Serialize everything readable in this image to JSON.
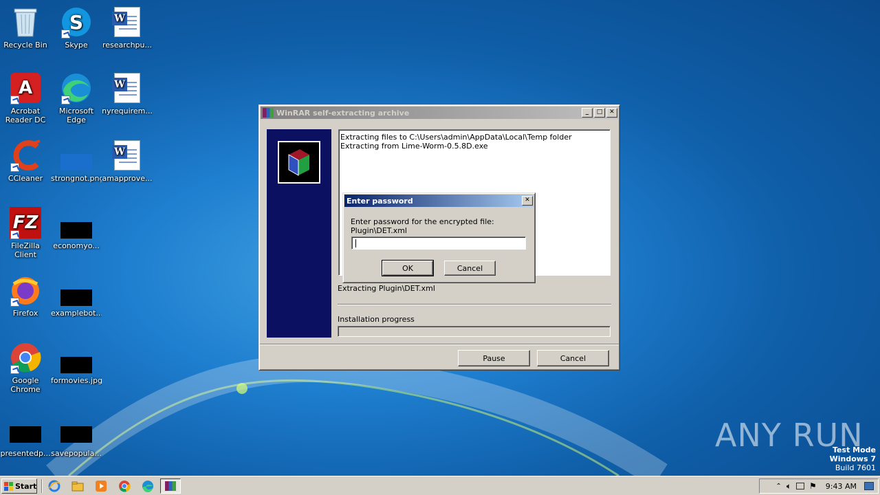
{
  "desktop": {
    "icons": [
      {
        "label": "Recycle Bin",
        "icon": "recycle-bin-icon"
      },
      {
        "label": "Skype",
        "icon": "skype-icon"
      },
      {
        "label": "researchpu...",
        "icon": "word-document-icon"
      },
      {
        "label": "Acrobat Reader DC",
        "icon": "acrobat-icon"
      },
      {
        "label": "Microsoft Edge",
        "icon": "edge-icon"
      },
      {
        "label": "nyrequirem...",
        "icon": "word-document-icon"
      },
      {
        "label": "CCleaner",
        "icon": "ccleaner-icon"
      },
      {
        "label": "strongnot.png",
        "icon": "image-file-icon"
      },
      {
        "label": "amapprove...",
        "icon": "word-document-icon"
      },
      {
        "label": "FileZilla Client",
        "icon": "filezilla-icon"
      },
      {
        "label": "economyo...",
        "icon": "image-thumbnail-icon"
      },
      {
        "label": "Firefox",
        "icon": "firefox-icon"
      },
      {
        "label": "examplebot...",
        "icon": "image-thumbnail-icon"
      },
      {
        "label": "Google Chrome",
        "icon": "chrome-icon"
      },
      {
        "label": "formovies.jpg",
        "icon": "image-thumbnail-icon"
      },
      {
        "label": "presentedp...",
        "icon": "image-thumbnail-icon"
      },
      {
        "label": "savepopula...",
        "icon": "image-thumbnail-icon"
      }
    ]
  },
  "winrar": {
    "title": "WinRAR self-extracting archive",
    "log_lines": [
      "Extracting files to C:\\Users\\admin\\AppData\\Local\\Temp folder",
      "Extracting from Lime-Worm-0.5.8D.exe"
    ],
    "status": "Extracting Plugin\\DET.xml",
    "progress_label": "Installation progress",
    "progress_value": 0,
    "pause_label": "Pause",
    "cancel_label": "Cancel"
  },
  "password_dialog": {
    "title": "Enter password",
    "prompt_line1": "Enter password for the encrypted file:",
    "prompt_line2": "Plugin\\DET.xml",
    "password_value": "",
    "ok_label": "OK",
    "cancel_label": "Cancel"
  },
  "taskbar": {
    "start_label": "Start",
    "clock": "9:43 AM"
  },
  "watermark": {
    "line1": "Test Mode",
    "line2": "Windows 7",
    "line3": "Build 7601",
    "brand": "ANY RUN"
  },
  "colors": {
    "title_active": "#0a246a",
    "title_inactive": "#808080",
    "sidebar": "#0b1060",
    "window_face": "#d4d0c8"
  }
}
